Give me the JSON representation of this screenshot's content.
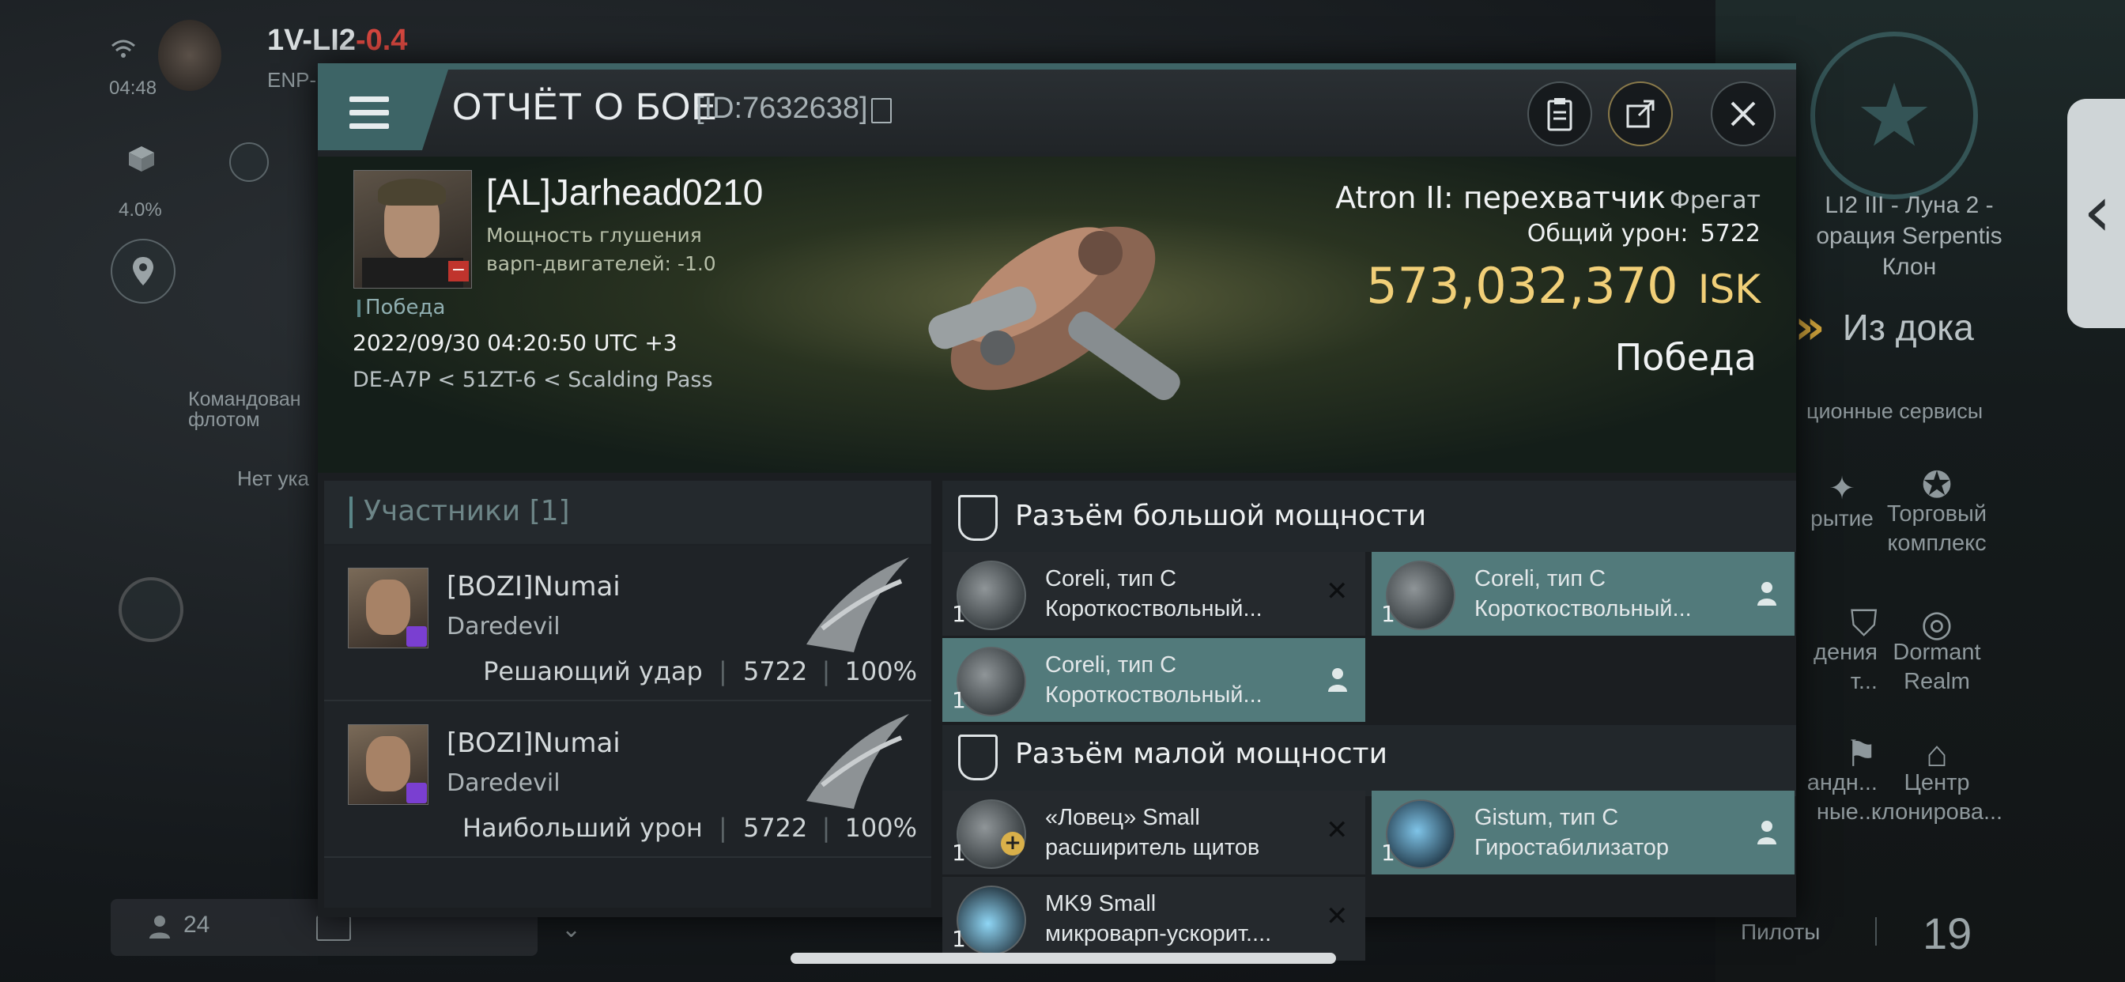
{
  "status_bar": {
    "system_name": "1V-LI2",
    "security": "-0.4",
    "region_code": "ENP-",
    "time": "04:48",
    "cargo_percent": "4.0%"
  },
  "background_left": {
    "fleet_label_1": "Командован",
    "fleet_label_2": "флотом",
    "no_fleet": "Нет ука",
    "online_count": "24"
  },
  "background_right": {
    "location_1": "LI2 III - Луна 2 -",
    "location_2": "орация Serpentis",
    "location_3": "Клон",
    "undock": "Из дока",
    "services": "ционные сервисы",
    "svc_1": "рытие",
    "svc_2a": "Торговый",
    "svc_2b": "комплекс",
    "svc_3a": "дения",
    "svc_3b": "т...",
    "svc_4a": "Dormant",
    "svc_4b": "Realm",
    "svc_5a": "андн...",
    "svc_5b": "ные...",
    "svc_6a": "Центр",
    "svc_6b": "клонирова...",
    "pilots_label": "Пилоты",
    "pilots_count": "19"
  },
  "modal": {
    "title": "ОТЧЁТ О БОЕ",
    "report_id": "[ID:7632638]",
    "victim": {
      "name": "[AL]Jarhead0210",
      "warp_line_1": "Мощность глушения",
      "warp_line_2": "варп-двигателей: -1.0",
      "result_tag": "Победа",
      "datetime": "2022/09/30 04:20:50 UTC +3",
      "location": "DE-A7P < 51ZT-6 < Scalding Pass"
    },
    "ship": {
      "name": "Atron II: перехватчик",
      "class": "Фрегат",
      "total_damage_label": "Общий урон:",
      "total_damage": "5722",
      "value": "573,032,370",
      "currency": "ISK",
      "outcome": "Победа"
    },
    "participants": {
      "label": "Участники",
      "count": "[1]",
      "items": [
        {
          "name": "[BOZI]Numai",
          "ship": "Daredevil",
          "role": "Решающий удар",
          "damage": "5722",
          "percent": "100%"
        },
        {
          "name": "[BOZI]Numai",
          "ship": "Daredevil",
          "role": "Наибольший урон",
          "damage": "5722",
          "percent": "100%"
        }
      ]
    },
    "high_slots": {
      "label": "Разъём большой мощности",
      "modules": [
        {
          "line1": "Coreli, тип C",
          "line2": "Короткоствольный...",
          "qty": "1",
          "state": "destroyed"
        },
        {
          "line1": "Coreli, тип C",
          "line2": "Короткоствольный...",
          "qty": "1",
          "state": "dropped"
        },
        {
          "line1": "Coreli, тип C",
          "line2": "Короткоствольный...",
          "qty": "1",
          "state": "dropped"
        }
      ]
    },
    "low_slots": {
      "label": "Разъём малой мощности",
      "modules": [
        {
          "line1": "«Ловец» Small",
          "line2": "расширитель щитов",
          "qty": "1",
          "state": "destroyed"
        },
        {
          "line1": "Gistum, тип C",
          "line2": "Гиростабилизатор",
          "qty": "1",
          "state": "dropped"
        },
        {
          "line1": "MK9 Small",
          "line2": "микроварп-ускорит....",
          "qty": "1",
          "state": "destroyed"
        }
      ]
    }
  },
  "colors": {
    "accent_teal": "#527a7b",
    "gold_value": "#f1cf78",
    "security_red": "#d6473f",
    "purple_badge": "#7a3fd1"
  }
}
